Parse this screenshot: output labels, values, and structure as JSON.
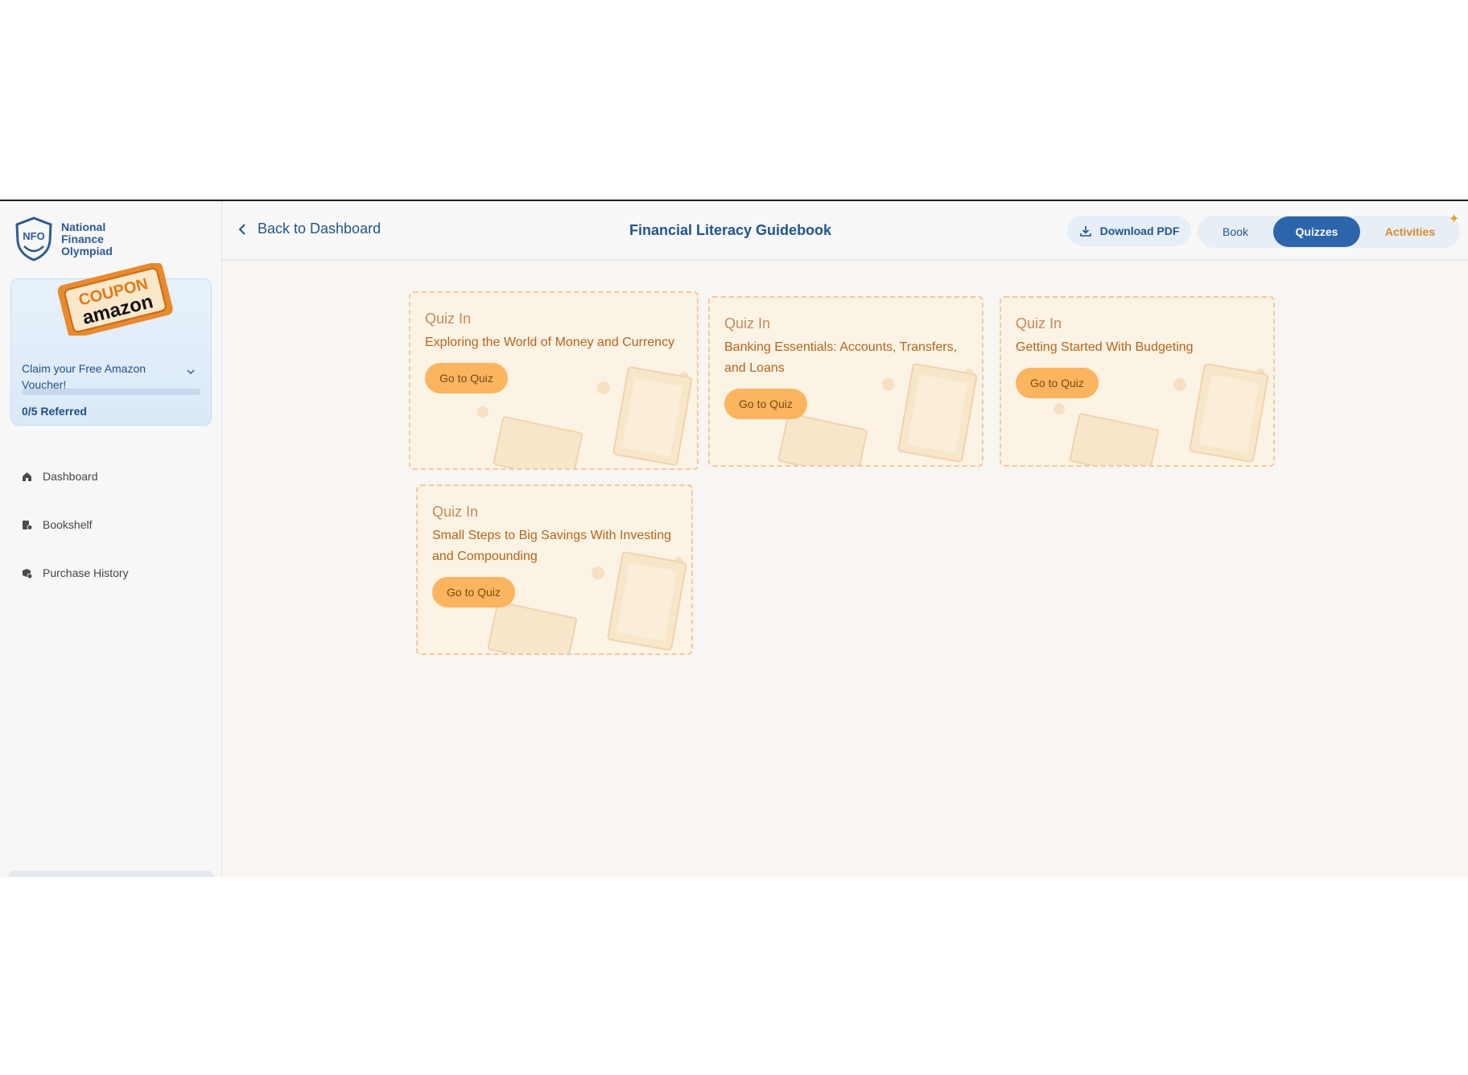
{
  "sidebar": {
    "logo_text": [
      "National",
      "Finance",
      "Olympiad"
    ],
    "logo_mark": "NFO",
    "coupon": {
      "tag_line1": "COUPON",
      "tag_line2": "amazon",
      "claim_text": "Claim your Free Amazon Voucher!",
      "progress_fraction": 0,
      "referred_text": "0/5 Referred"
    },
    "nav": [
      {
        "label": "Dashboard",
        "icon": "home-icon"
      },
      {
        "label": "Bookshelf",
        "icon": "bookshelf-icon"
      },
      {
        "label": "Purchase History",
        "icon": "purchase-history-icon"
      }
    ]
  },
  "header": {
    "back_label": "Back to Dashboard",
    "title": "Financial Literacy Guidebook",
    "download_label": "Download PDF",
    "tabs": {
      "book": "Book",
      "quizzes": "Quizzes",
      "activities": "Activities"
    },
    "active_tab": "Quizzes"
  },
  "quizzes": [
    {
      "label": "Quiz In",
      "title": "Exploring the World of Money and Currency",
      "button": "Go to Quiz"
    },
    {
      "label": "Quiz In",
      "title": "Banking Essentials: Accounts, Transfers, and Loans",
      "button": "Go to Quiz"
    },
    {
      "label": "Quiz In",
      "title": "Getting Started With Budgeting",
      "button": "Go to Quiz"
    },
    {
      "label": "Quiz In",
      "title": "Small Steps to Big Savings With Investing and Compounding",
      "button": "Go to Quiz"
    }
  ],
  "colors": {
    "primary": "#2d65ad",
    "accent": "#fbb55f",
    "card_bg": "#fbf3e4"
  }
}
